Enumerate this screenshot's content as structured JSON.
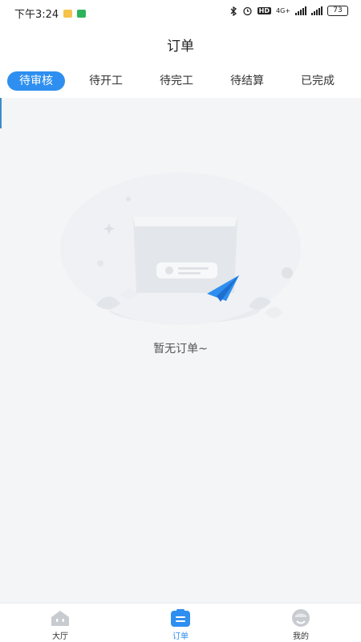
{
  "status_bar": {
    "time": "下午3:24",
    "network": "4G+",
    "hd_badge": "HD",
    "battery": "73"
  },
  "header": {
    "title": "订单"
  },
  "tabs": [
    {
      "label": "待审核",
      "active": true
    },
    {
      "label": "待开工",
      "active": false
    },
    {
      "label": "待完工",
      "active": false
    },
    {
      "label": "待结算",
      "active": false
    },
    {
      "label": "已完成",
      "active": false
    }
  ],
  "empty_state": {
    "message": "暂无订单~"
  },
  "bottom_nav": [
    {
      "label": "大厅",
      "icon": "hall-icon",
      "active": false
    },
    {
      "label": "订单",
      "icon": "order-icon",
      "active": true
    },
    {
      "label": "我的",
      "icon": "profile-icon",
      "active": false
    }
  ],
  "colors": {
    "accent": "#2e8ff0",
    "background": "#f4f5f7",
    "icon_gray": "#c8cbd0"
  }
}
